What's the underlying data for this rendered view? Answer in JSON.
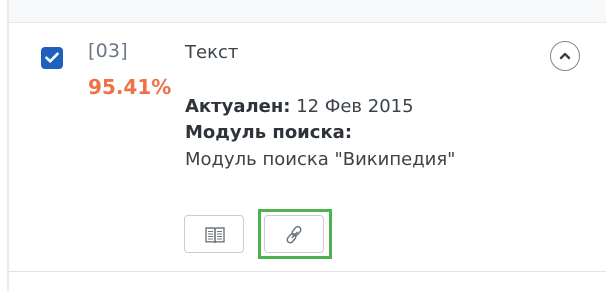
{
  "result": {
    "checked": true,
    "index": "[03]",
    "percent": "95.41%",
    "type": "Текст",
    "actual_label": "Актуален:",
    "actual_value": "12 Фев 2015",
    "module_label": "Модуль поиска:",
    "module_value": "Модуль поиска \"Википедия\""
  },
  "icons": {
    "checkbox": "checkmark-icon",
    "collapse": "chevron-up-icon",
    "book": "book-icon",
    "link": "link-icon"
  },
  "colors": {
    "checkbox": "#1f5fbd",
    "percent": "#f07048",
    "highlight": "#4cb34f",
    "text": "#3b4249"
  }
}
